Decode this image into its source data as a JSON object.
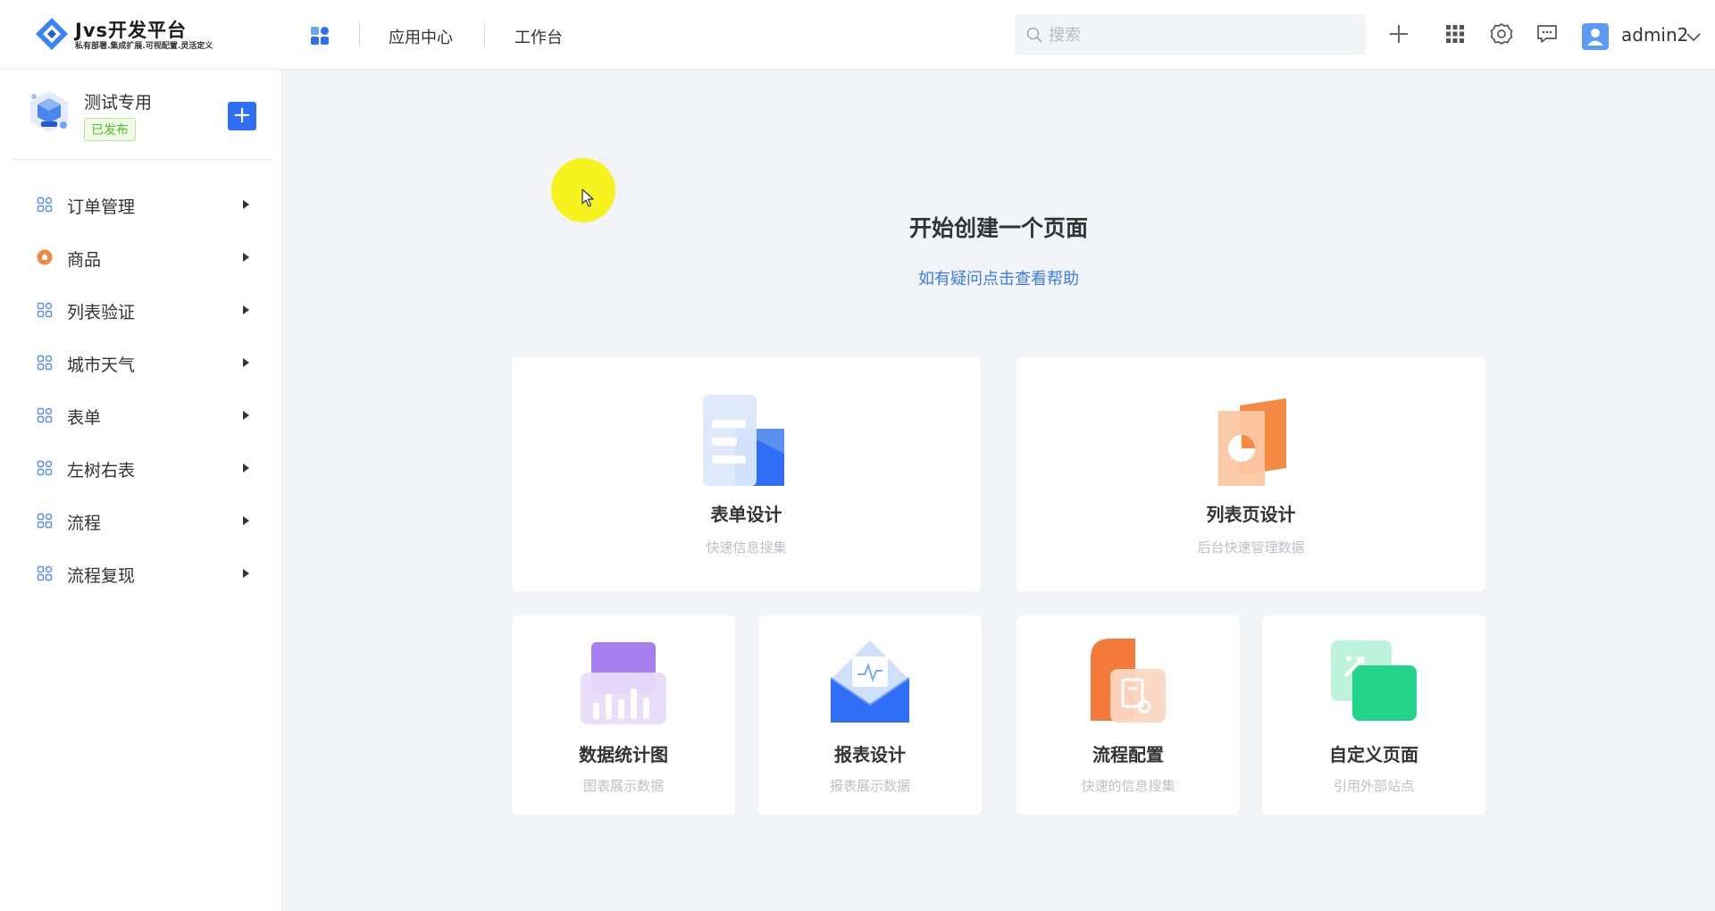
{
  "header": {
    "logo": {
      "title": "Jvs开发平台",
      "subtitle": "私有部署.集成扩展.可视配置.灵活定义"
    },
    "nav": [
      {
        "label": "应用中心"
      },
      {
        "label": "工作台"
      }
    ],
    "search": {
      "placeholder": "搜索",
      "value": ""
    },
    "icons": [
      "plus-icon",
      "grid-icon",
      "gear-icon",
      "message-icon"
    ],
    "user": {
      "name": "admin2"
    }
  },
  "sidebar": {
    "app": {
      "name": "测试专用",
      "status": "已发布"
    },
    "add_label": "+",
    "items": [
      {
        "label": "订单管理",
        "icon": "apps-icon"
      },
      {
        "label": "商品",
        "icon": "product-icon"
      },
      {
        "label": "列表验证",
        "icon": "apps-icon"
      },
      {
        "label": "城市天气",
        "icon": "apps-icon"
      },
      {
        "label": "表单",
        "icon": "apps-icon"
      },
      {
        "label": "左树右表",
        "icon": "apps-icon"
      },
      {
        "label": "流程",
        "icon": "apps-icon"
      },
      {
        "label": "流程复现",
        "icon": "apps-icon"
      }
    ]
  },
  "main": {
    "title": "开始创建一个页面",
    "help": "如有疑问点击查看帮助",
    "cards": [
      {
        "title": "表单设计",
        "desc": "快速信息搜集",
        "icon": "form-design-icon"
      },
      {
        "title": "列表页设计",
        "desc": "后台快速管理数据",
        "icon": "list-design-icon"
      },
      {
        "title": "数据统计图",
        "desc": "图表展示数据",
        "icon": "chart-icon"
      },
      {
        "title": "报表设计",
        "desc": "报表展示数据",
        "icon": "report-icon"
      },
      {
        "title": "流程配置",
        "desc": "快速的信息搜集",
        "icon": "workflow-icon"
      },
      {
        "title": "自定义页面",
        "desc": "引用外部站点",
        "icon": "custom-page-icon"
      }
    ]
  },
  "colors": {
    "accent": "#2f6ef6",
    "link": "#3a7bf0",
    "published": "#52c41a",
    "background": "#f2f3f7"
  }
}
